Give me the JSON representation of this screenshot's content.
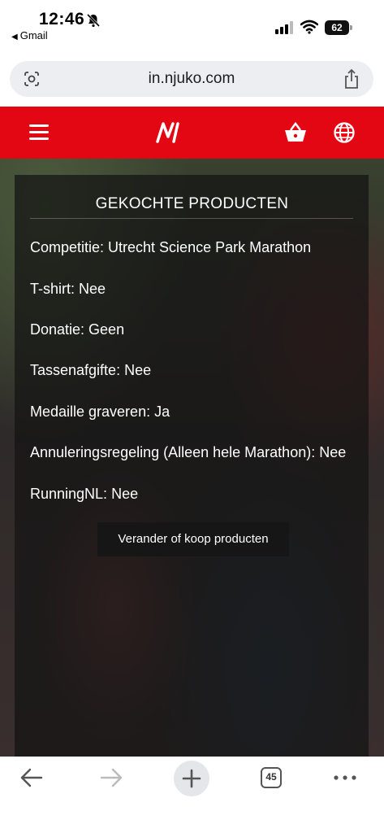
{
  "status_bar": {
    "time": "12:46",
    "back_app": "Gmail",
    "battery": "62",
    "icons": [
      "bell-slash-icon",
      "signal-icon",
      "wifi-icon",
      "battery-icon"
    ]
  },
  "browser": {
    "url": "in.njuko.com",
    "tab_count": "45",
    "icons": [
      "camera-icon",
      "share-icon",
      "back-arrow-icon",
      "forward-arrow-icon",
      "plus-icon",
      "more-icon"
    ]
  },
  "site_header": {
    "background_color": "#e30613",
    "icons": [
      "menu-icon",
      "njuko-logo-icon",
      "basket-icon",
      "globe-icon"
    ]
  },
  "panel": {
    "title": "GEKOCHTE PRODUCTEN",
    "rows": [
      "Competitie: Utrecht Science Park Marathon",
      "T-shirt: Nee",
      "Donatie: Geen",
      "Tassenafgifte: Nee",
      "Medaille graveren: Ja",
      "Annuleringsregeling  (Alleen hele Marathon): Nee",
      "RunningNL: Nee"
    ],
    "button_label": "Verander of koop producten"
  }
}
